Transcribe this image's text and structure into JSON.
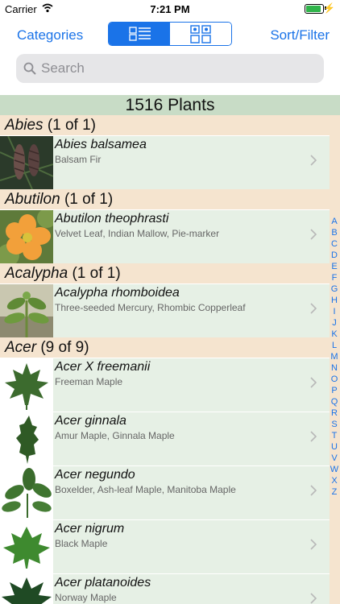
{
  "status": {
    "carrier": "Carrier",
    "time": "7:21 PM",
    "bolt": "⚡"
  },
  "nav": {
    "left_label": "Categories",
    "right_label": "Sort/Filter"
  },
  "search": {
    "placeholder": "Search"
  },
  "count_label": "1516 Plants",
  "sections": [
    {
      "genus": "Abies",
      "count": "(1 of 1)",
      "items": [
        {
          "scientific": "Abies balsamea",
          "common": "Balsam Fir",
          "thumb": "cones-photo"
        }
      ]
    },
    {
      "genus": "Abutilon",
      "count": "(1 of 1)",
      "items": [
        {
          "scientific": "Abutilon theophrasti",
          "common": "Velvet Leaf, Indian Mallow, Pie-marker",
          "thumb": "flower-photo"
        }
      ]
    },
    {
      "genus": "Acalypha",
      "count": "(1 of 1)",
      "items": [
        {
          "scientific": "Acalypha rhomboidea",
          "common": "Three-seeded Mercury, Rhombic Copperleaf",
          "thumb": "plant-photo"
        }
      ]
    },
    {
      "genus": "Acer",
      "count": "(9 of 9)",
      "items": [
        {
          "scientific": "Acer X freemanii",
          "common": "Freeman Maple",
          "thumb": "maple-leaf"
        },
        {
          "scientific": "Acer ginnala",
          "common": "Amur Maple, Ginnala Maple",
          "thumb": "narrow-leaf"
        },
        {
          "scientific": "Acer negundo",
          "common": "Boxelder, Ash-leaf Maple, Manitoba Maple",
          "thumb": "compound-leaf"
        },
        {
          "scientific": "Acer nigrum",
          "common": "Black Maple",
          "thumb": "maple-leaf"
        },
        {
          "scientific": "Acer platanoides",
          "common": "Norway Maple",
          "thumb": "maple-leaf"
        }
      ]
    }
  ],
  "index_letters": [
    "A",
    "B",
    "C",
    "D",
    "E",
    "F",
    "G",
    "H",
    "I",
    "J",
    "K",
    "L",
    "M",
    "N",
    "O",
    "P",
    "Q",
    "R",
    "S",
    "T",
    "U",
    "V",
    "W",
    "X",
    "Z"
  ],
  "colors": {
    "accent": "#1a73e8",
    "row_bg": "#e6f0e5",
    "section_bg": "#f5e4cf",
    "count_bg": "#c8dcc6"
  }
}
